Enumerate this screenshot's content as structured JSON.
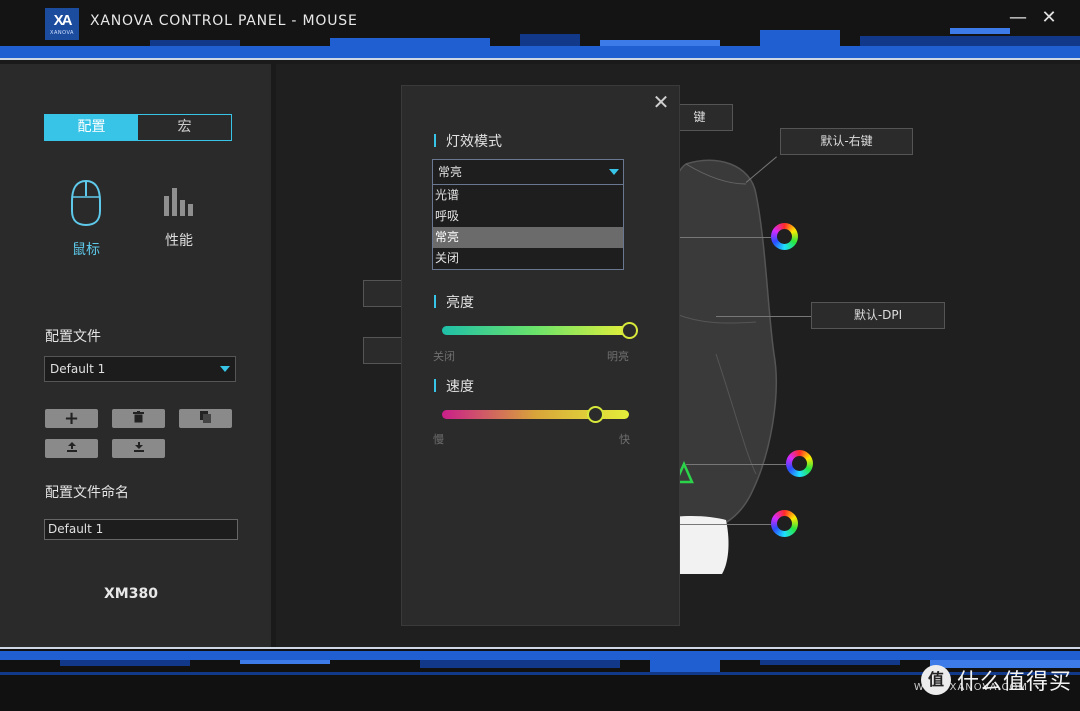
{
  "window": {
    "title": "XANOVA CONTROL PANEL - MOUSE",
    "logo_mark": "XA",
    "logo_brand": "XANOVA",
    "minimize_glyph": "—",
    "close_glyph": "✕"
  },
  "sidebar": {
    "tabs": [
      {
        "label": "配置",
        "active": true
      },
      {
        "label": "宏",
        "active": false
      }
    ],
    "nav": {
      "mouse_label": "鼠标",
      "performance_label": "性能"
    },
    "profile_label": "配置文件",
    "profile_value": "Default 1",
    "profile_name_label": "配置文件命名",
    "profile_name_value": "Default 1",
    "tool_buttons": [
      {
        "icon": "plus-icon",
        "glyph": "+"
      },
      {
        "icon": "trash-icon",
        "glyph": "🗑"
      },
      {
        "icon": "copy-icon",
        "glyph": "❐"
      },
      {
        "icon": "export-icon",
        "glyph": "⇧"
      },
      {
        "icon": "import-icon",
        "glyph": "⇩"
      }
    ],
    "model": "XM380"
  },
  "main": {
    "callouts": {
      "top_partial": "键",
      "right_button": "默认-右键",
      "dpi": "默认-DPI"
    }
  },
  "lighting_dialog": {
    "close_glyph": "✕",
    "effect_mode_label": "灯效模式",
    "selected_mode": "常亮",
    "options": [
      "光谱",
      "呼吸",
      "常亮",
      "关闭"
    ],
    "highlighted_option": "常亮",
    "brightness": {
      "label": "亮度",
      "min_label": "关闭",
      "max_label": "明亮",
      "value_fraction": 1.0
    },
    "speed": {
      "label": "速度",
      "min_label": "慢",
      "max_label": "快",
      "value_fraction": 0.82
    }
  },
  "watermark": {
    "logo_char": "值",
    "text": "什么值得买",
    "url": "WWW.XANOVA.COM"
  },
  "colors": {
    "accent": "#38c4e6",
    "band_blue": "#1f5fd1",
    "slider_knob": "#d7e83b"
  }
}
